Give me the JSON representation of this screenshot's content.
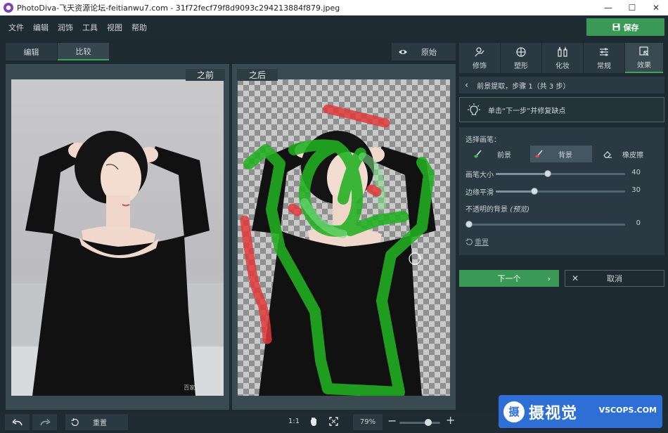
{
  "window": {
    "title": "PhotoDiva-飞天资源论坛-feitianwu7.com - 31f72fecf79f8d9093c294213884f879.jpeg",
    "minimize": "—",
    "maximize": "☐",
    "close": "✕"
  },
  "menu": [
    "文件",
    "编辑",
    "润饰",
    "工具",
    "视图",
    "帮助"
  ],
  "toolbar": {
    "save_label": "保存",
    "tabs": [
      {
        "label": "编辑",
        "active": false
      },
      {
        "label": "比较",
        "active": true
      }
    ],
    "original_label": "原始"
  },
  "canvas": {
    "before_label": "之前",
    "after_label": "之后",
    "watermark": "百家号/摄视界"
  },
  "tools": {
    "tabs": [
      {
        "label": "修饰",
        "icon": "retouch-icon",
        "active": false
      },
      {
        "label": "塑形",
        "icon": "reshape-icon",
        "active": false
      },
      {
        "label": "化妆",
        "icon": "makeup-icon",
        "active": false
      },
      {
        "label": "常规",
        "icon": "sliders-icon",
        "active": false
      },
      {
        "label": "效果",
        "icon": "effects-icon",
        "active": true
      }
    ]
  },
  "step": {
    "text": "前景提取，步骤 1（共 3 步）",
    "hint": "单击“下一步”并修复缺点"
  },
  "brush": {
    "title": "选择画笔：",
    "options": [
      {
        "label": "前景",
        "active": false
      },
      {
        "label": "背景",
        "active": true
      },
      {
        "label": "橡皮擦",
        "active": false
      }
    ],
    "size": {
      "label": "画笔大小",
      "value": 40,
      "max": 100
    },
    "feather": {
      "label": "边缘平滑",
      "value": 30,
      "max": 100
    },
    "opacity": {
      "label": "不透明的背景",
      "note": "(预览)",
      "value": 0,
      "max": 100
    },
    "reset": "重置"
  },
  "actions": {
    "next": "下一个",
    "cancel": "取消"
  },
  "bottom": {
    "reset": "重置",
    "ratio": "1:1",
    "zoom": "79%",
    "zoom_value": 79
  },
  "badge": {
    "mark": "摄",
    "name": "摄视觉",
    "domain": "VSCOPS.COM"
  },
  "colors": {
    "accent": "#3a9a55",
    "foreground_brush": "#21b021",
    "background_brush": "#e23a3a"
  }
}
